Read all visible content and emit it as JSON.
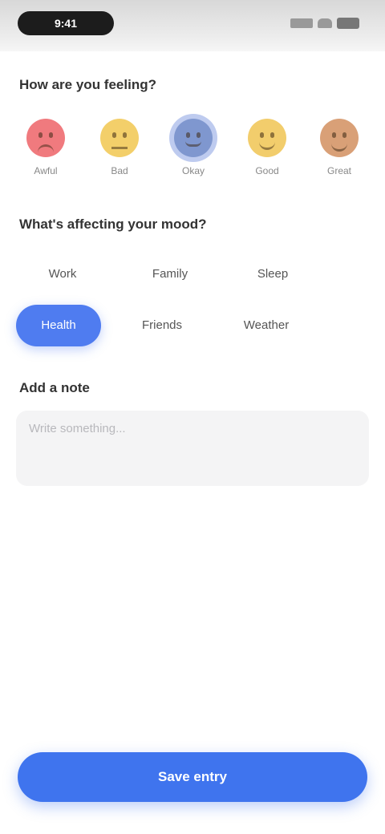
{
  "status_bar": {
    "time": "9:41"
  },
  "mood_section": {
    "title": "How are you feeling?",
    "moods": [
      {
        "label": "Awful",
        "color": "#f07a7e",
        "icon": "sad-face-icon"
      },
      {
        "label": "Bad",
        "color": "#f3cf6a",
        "icon": "frown-face-icon"
      },
      {
        "label": "Okay",
        "color": "#7f97cf",
        "icon": "neutral-face-icon",
        "selected": true
      },
      {
        "label": "Good",
        "color": "#f2cd6c",
        "icon": "smile-face-icon"
      },
      {
        "label": "Great",
        "color": "#d9a077",
        "icon": "happy-face-icon"
      }
    ]
  },
  "category_section": {
    "title": "What's affecting your mood?",
    "chips": [
      {
        "label": "Work"
      },
      {
        "label": "Family"
      },
      {
        "label": "Sleep"
      },
      {
        "label": "Health",
        "active": true
      },
      {
        "label": "Friends"
      },
      {
        "label": "Weather"
      }
    ]
  },
  "notes_section": {
    "title": "Add a note",
    "placeholder": "Write something...",
    "value": ""
  },
  "save_button": {
    "label": "Save entry"
  },
  "colors": {
    "accent": "#3f74ee",
    "chip_active": "#4f7cf0",
    "input_bg": "#f4f4f5"
  }
}
